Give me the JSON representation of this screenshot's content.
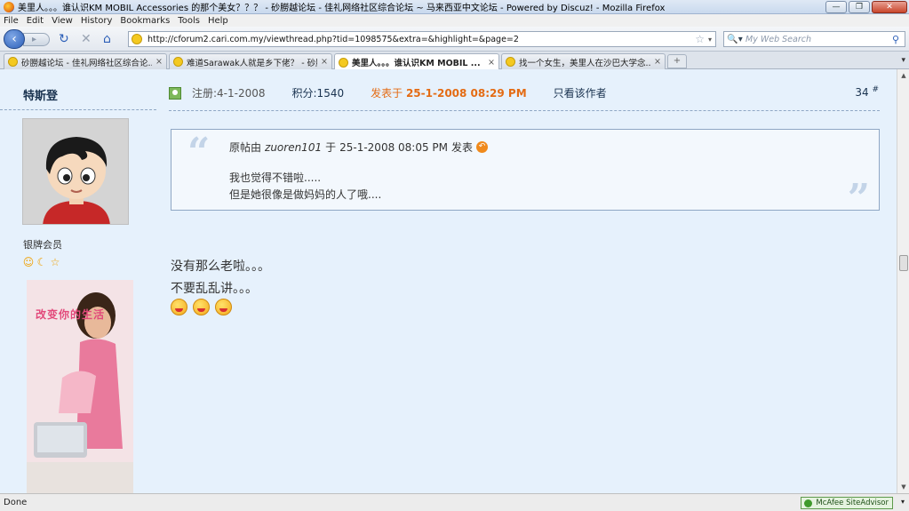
{
  "window": {
    "title": "美里人。。。谁认识KM MOBIL Accessories 的那个美女？？？ - 砂朥越论坛 - 佳礼网络社区综合论坛 ~ 马来西亚中文论坛 - Powered by Discuz! - Mozilla Firefox",
    "minimize": "—",
    "maximize": "❐",
    "close": "✕"
  },
  "menu": [
    "File",
    "Edit",
    "View",
    "History",
    "Bookmarks",
    "Tools",
    "Help"
  ],
  "nav": {
    "url": "http://cforum2.cari.com.my/viewthread.php?tid=1098575&extra=&highlight=&page=2",
    "search_placeholder": "My Web Search",
    "search_engine": "🔍▾"
  },
  "tabs": [
    {
      "label": "砂朥越论坛 - 佳礼网络社区综合论...",
      "active": false
    },
    {
      "label": "难道Sarawak人就是乡下佬？ - 砂朥...",
      "active": false
    },
    {
      "label": "美里人。。。谁认识KM MOBIL ...",
      "active": true
    },
    {
      "label": "找一个女生，美里人在沙巴大学念...",
      "active": false
    }
  ],
  "sidebar": {
    "author": "特斯登",
    "rank": "银牌会员",
    "promo_text": "改变你的生活"
  },
  "post": {
    "register": "注册:4-1-2008",
    "score": "积分:1540",
    "posted_prefix": "发表于",
    "posted_time": "25-1-2008 08:29 PM",
    "view_author_only": "只看该作者",
    "floor": "34",
    "floor_mark": "#",
    "quote": {
      "prefix": "原帖由",
      "user": "zuoren101",
      "at": "于",
      "time": "25-1-2008 08:05 PM",
      "suffix": "发表",
      "lines": [
        "我也觉得不错啦.....",
        "但是她很像是做妈妈的人了哦...."
      ]
    },
    "lines": [
      "没有那么老啦。。。",
      "不要乱乱讲。。。"
    ]
  },
  "status": {
    "text": "Done",
    "addon": "McAfee SiteAdvisor"
  }
}
